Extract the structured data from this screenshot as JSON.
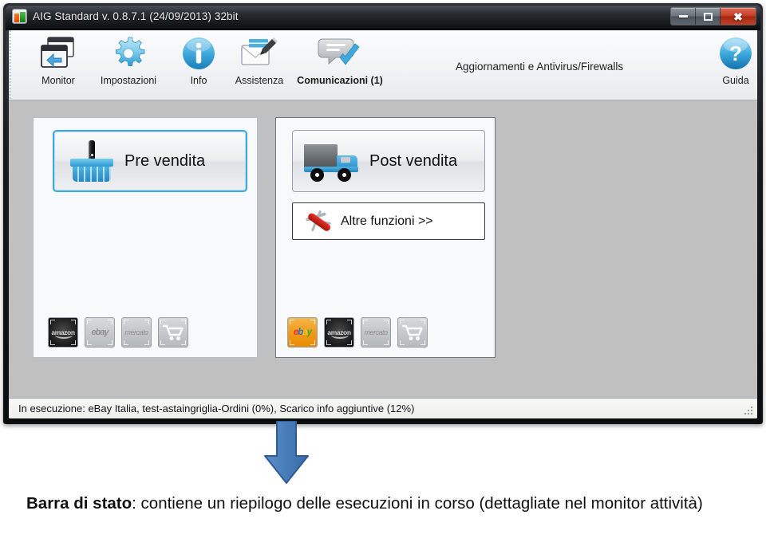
{
  "window": {
    "title": "AIG Standard v. 0.8.7.1 (24/09/2013) 32bit",
    "app_icon": "aig-app-icon",
    "controls": {
      "minimize": "minimize-icon",
      "maximize": "maximize-icon",
      "close": "close-icon"
    }
  },
  "toolbar": {
    "items": [
      {
        "label": "Monitor",
        "icon": "monitor-windows-icon",
        "bold": false
      },
      {
        "label": "Impostazioni",
        "icon": "gear-icon",
        "bold": false
      },
      {
        "label": "Info",
        "icon": "info-circle-icon",
        "bold": false
      },
      {
        "label": "Assistenza",
        "icon": "envelope-pencil-icon",
        "bold": false
      },
      {
        "label": "Comunicazioni (1)",
        "icon": "chat-check-icon",
        "bold": true
      }
    ],
    "ribbon_title": "Aggiornamenti e Antivirus/Firewalls",
    "help": {
      "label": "Guida",
      "icon": "question-circle-icon"
    }
  },
  "panels": {
    "left": {
      "button": {
        "label": "Pre vendita",
        "icon": "shopping-basket-icon",
        "selected": true
      },
      "marketplaces": [
        {
          "name": "amazon",
          "label": "amazon",
          "state": "active-dark"
        },
        {
          "name": "ebay",
          "label": "ebay",
          "state": "inactive"
        },
        {
          "name": "mercato",
          "label": "mercato",
          "state": "inactive"
        },
        {
          "name": "cart",
          "label": "cart",
          "state": "inactive"
        }
      ]
    },
    "right": {
      "buttons": [
        {
          "label": "Post vendita",
          "icon": "delivery-truck-icon",
          "selected": false
        },
        {
          "label": "Altre funzioni >>",
          "icon": "swiss-knife-icon",
          "selected": false
        }
      ],
      "marketplaces": [
        {
          "name": "ebay",
          "label": "ebay",
          "state": "active-orange"
        },
        {
          "name": "amazon",
          "label": "amazon",
          "state": "inactive-dark"
        },
        {
          "name": "mercato",
          "label": "mercato",
          "state": "inactive"
        },
        {
          "name": "cart",
          "label": "cart",
          "state": "inactive"
        }
      ]
    }
  },
  "status_bar": {
    "text": "In esecuzione: eBay Italia, test-astaingriglia-Ordini (0%), Scarico info aggiuntive (12%)",
    "grip": "resize-grip-icon"
  },
  "annotation": {
    "arrow": "down-arrow-icon",
    "arrow_fill": "#4a7ebb",
    "arrow_stroke": "#2e5b94",
    "caption_bold": "Barra di stato",
    "caption_rest": ": contiene un riepilogo delle esecuzioni in corso (dettagliate nel monitor attività)"
  },
  "colors": {
    "accent_blue": "#3fa9dd",
    "ebay_orange": "#ef9a17",
    "window_chrome": "#1a1d20",
    "client_bg": "#c0c0c0"
  }
}
